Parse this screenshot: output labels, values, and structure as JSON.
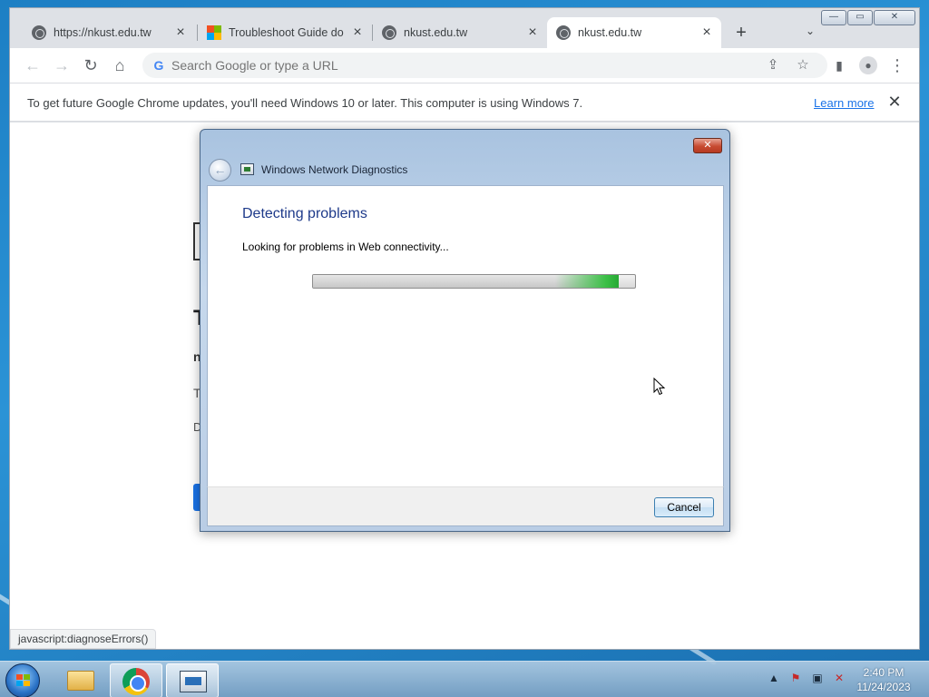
{
  "browser": {
    "tabs": [
      {
        "title": "https://nkust.edu.tw",
        "favicon": "globe-icon",
        "active": false
      },
      {
        "title": "Troubleshoot Guide do",
        "favicon": "microsoft-logo-icon",
        "active": false
      },
      {
        "title": "nkust.edu.tw",
        "favicon": "globe-icon",
        "active": false
      },
      {
        "title": "nkust.edu.tw",
        "favicon": "globe-icon",
        "active": true
      }
    ],
    "address_placeholder": "Search Google or type a URL",
    "infobar": {
      "message": "To get future Google Chrome updates, you'll need Windows 10 or later. This computer is using Windows 7.",
      "link": "Learn more"
    },
    "status_url": "javascript:diagnoseErrors()",
    "page_fragments": [
      "T",
      "n",
      "T",
      "D"
    ]
  },
  "dialog": {
    "title": "Windows Network Diagnostics",
    "heading": "Detecting problems",
    "message": "Looking for problems in Web connectivity...",
    "cancel_label": "Cancel",
    "progress": 0.95
  },
  "taskbar": {
    "time": "2:40 PM",
    "date": "11/24/2023"
  },
  "colors": {
    "accent": "#1a73e8",
    "heading": "#1e3a8a",
    "progress_green": "#3bbf46",
    "desktop": "#2b93d6"
  }
}
